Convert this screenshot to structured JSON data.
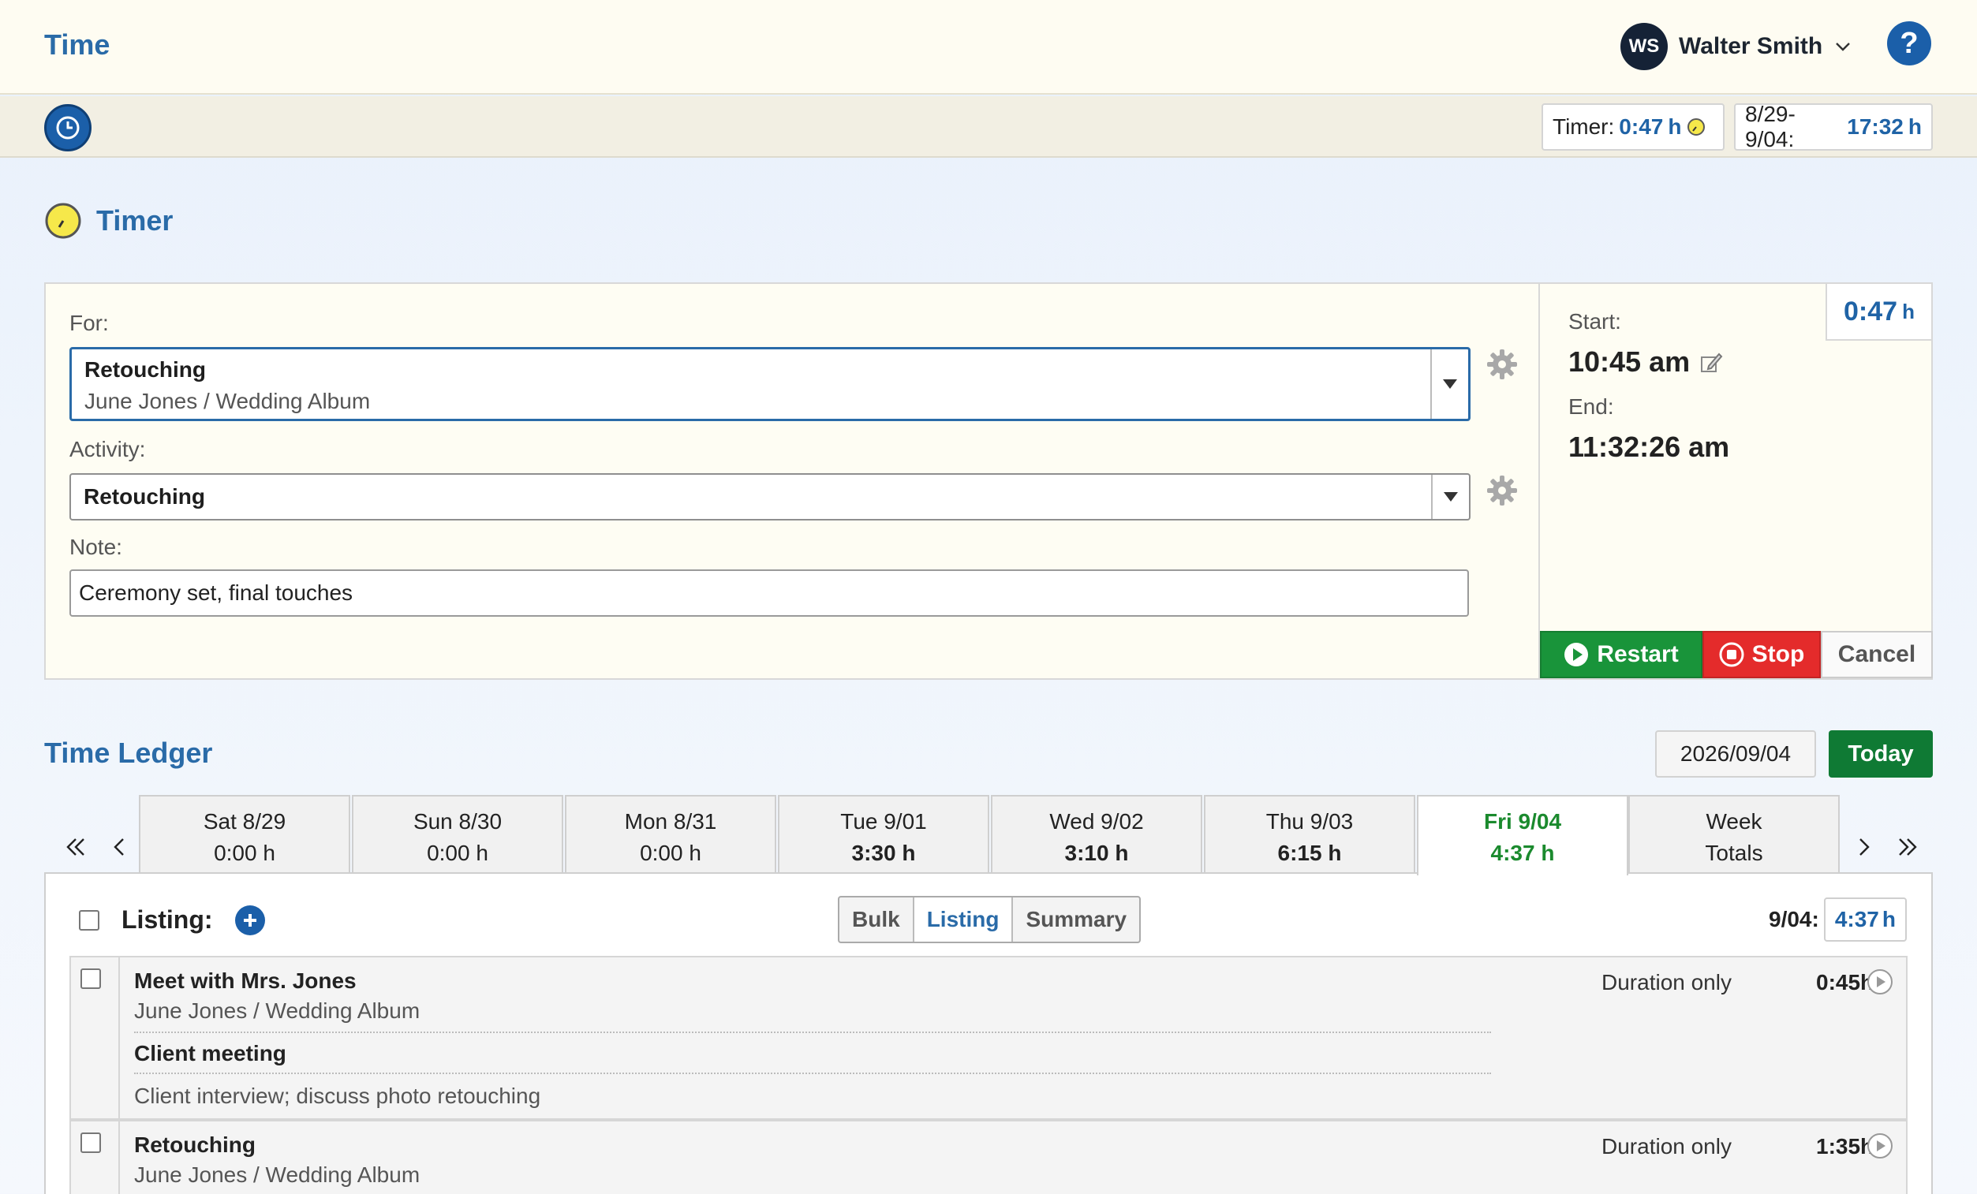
{
  "header": {
    "app_title": "Time",
    "user_initials": "WS",
    "user_name": "Walter Smith",
    "help_label": "?"
  },
  "subbar": {
    "timer_label": "Timer:",
    "timer_value": "0:47",
    "timer_unit": "h",
    "week_label": "8/29-9/04:",
    "week_value": "17:32",
    "week_unit": "h"
  },
  "timer": {
    "section_title": "Timer",
    "for_label": "For:",
    "for_value": "Retouching",
    "for_sub": "June Jones / Wedding Album",
    "activity_label": "Activity:",
    "activity_value": "Retouching",
    "note_label": "Note:",
    "note_value": "Ceremony set, final touches",
    "elapsed": "0:47",
    "elapsed_unit": "h",
    "start_label": "Start:",
    "start_value": "10:45 am",
    "end_label": "End:",
    "end_value": "11:32:26 am",
    "restart_label": "Restart",
    "stop_label": "Stop",
    "cancel_label": "Cancel"
  },
  "ledger": {
    "section_title": "Time Ledger",
    "date_value": "2026/09/04",
    "today_label": "Today",
    "days": [
      {
        "day": "Sat 8/29",
        "total": "0:00 h"
      },
      {
        "day": "Sun 8/30",
        "total": "0:00 h"
      },
      {
        "day": "Mon 8/31",
        "total": "0:00 h"
      },
      {
        "day": "Tue 9/01",
        "total": "3:30 h"
      },
      {
        "day": "Wed 9/02",
        "total": "3:10 h"
      },
      {
        "day": "Thu 9/03",
        "total": "6:15 h"
      },
      {
        "day": "Fri 9/04",
        "total": "4:37 h"
      },
      {
        "day": "Week",
        "total": "Totals"
      }
    ],
    "listing_label": "Listing:",
    "views": [
      "Bulk",
      "Listing",
      "Summary"
    ],
    "day_total_label": "9/04:",
    "day_total_value": "4:37",
    "day_total_unit": "h",
    "entries": [
      {
        "title": "Meet with Mrs. Jones",
        "client": "June Jones / Wedding Album",
        "activity": "Client meeting",
        "note": "Client interview; discuss photo retouching",
        "mode": "Duration only",
        "duration": "0:45h"
      },
      {
        "title": "Retouching",
        "client": "June Jones / Wedding Album",
        "mode": "Duration only",
        "duration": "1:35h"
      }
    ]
  },
  "colors": {
    "accent": "#2a6ba8",
    "restart": "#19943a",
    "stop": "#e42b2b",
    "today": "#0f7a34",
    "active_day": "#1b8a2e"
  }
}
